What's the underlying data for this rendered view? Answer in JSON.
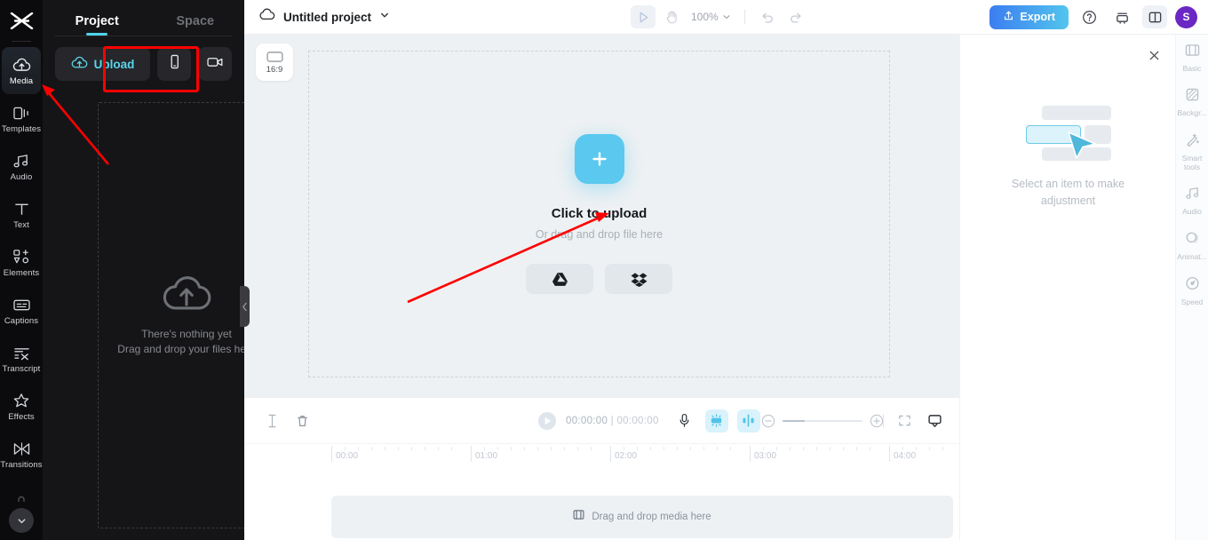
{
  "left_rail": {
    "logo": "capcut-logo",
    "items": [
      {
        "label": "Media",
        "icon": "cloud-upload-icon",
        "active": true
      },
      {
        "label": "Templates",
        "icon": "templates-icon",
        "active": false
      },
      {
        "label": "Audio",
        "icon": "music-note-icon",
        "active": false
      },
      {
        "label": "Text",
        "icon": "text-icon",
        "active": false
      },
      {
        "label": "Elements",
        "icon": "elements-icon",
        "active": false
      },
      {
        "label": "Captions",
        "icon": "captions-icon",
        "active": false
      },
      {
        "label": "Transcript",
        "icon": "transcript-icon",
        "active": false
      },
      {
        "label": "Effects",
        "icon": "sparkle-effects-icon",
        "active": false
      },
      {
        "label": "Transitions",
        "icon": "transitions-icon",
        "active": false
      }
    ],
    "collapse": "chevron-down-icon"
  },
  "panel": {
    "tabs": [
      {
        "label": "Project",
        "active": true
      },
      {
        "label": "Space",
        "active": false
      }
    ],
    "upload_label": "Upload",
    "device_button": "phone-icon",
    "record_button": "camera-icon",
    "empty_title": "There's nothing yet",
    "empty_subtitle": "Drag and drop your files here",
    "highlight_color": "#ff0000"
  },
  "topbar": {
    "cloud_icon": "cloud-icon",
    "project_title": "Untitled project",
    "project_caret": "chevron-down-icon",
    "select_tool": "cursor-select-icon",
    "hand_tool": "hand-icon",
    "zoom_level": "100%",
    "undo": "undo-icon",
    "redo": "redo-icon",
    "export_label": "Export",
    "help_icon": "question-mark-icon",
    "layout_icon": "stack-icon",
    "panel_toggle_icon": "split-panel-icon",
    "avatar_initial": "S",
    "export_gradient_from": "#3b7df0",
    "export_gradient_to": "#52c5ee",
    "avatar_color": "#6b27c4"
  },
  "stage": {
    "ratio_label": "16:9",
    "plus_icon": "plus-icon",
    "upload_title": "Click to upload",
    "upload_subtitle": "Or drag and drop file here",
    "cloud_sources": [
      {
        "name": "google-drive-icon"
      },
      {
        "name": "dropbox-icon"
      }
    ],
    "accent": "#5ac8ef"
  },
  "timeline": {
    "split_icon": "split-clip-icon",
    "delete_icon": "trash-icon",
    "play_icon": "play-icon",
    "current_time": "00:00:00",
    "separator": "|",
    "total_time": "00:00:00",
    "mic_icon": "microphone-icon",
    "autocut_icon": "magic-cut-icon",
    "split_audio_icon": "audio-split-icon",
    "zoom_out_icon": "minus-circle-icon",
    "zoom_in_icon": "plus-circle-icon",
    "fit_icon": "fit-screen-icon",
    "display_icon": "monitor-icon",
    "ruler_labels": [
      "00:00",
      "01:00",
      "02:00",
      "03:00",
      "04:00"
    ],
    "drop_hint": "Drag and drop media here",
    "drop_icon": "film-icon"
  },
  "props": {
    "close_icon": "close-icon",
    "empty_text": "Select an item to make adjustment"
  },
  "right_rail": {
    "items": [
      {
        "label": "Basic",
        "icon": "film-strip-icon"
      },
      {
        "label": "Backgr...",
        "icon": "background-icon"
      },
      {
        "label": "Smart tools",
        "icon": "magic-wand-icon"
      },
      {
        "label": "Audio",
        "icon": "music-note-icon"
      },
      {
        "label": "Animat...",
        "icon": "animation-icon"
      },
      {
        "label": "Speed",
        "icon": "speedometer-icon"
      }
    ]
  }
}
